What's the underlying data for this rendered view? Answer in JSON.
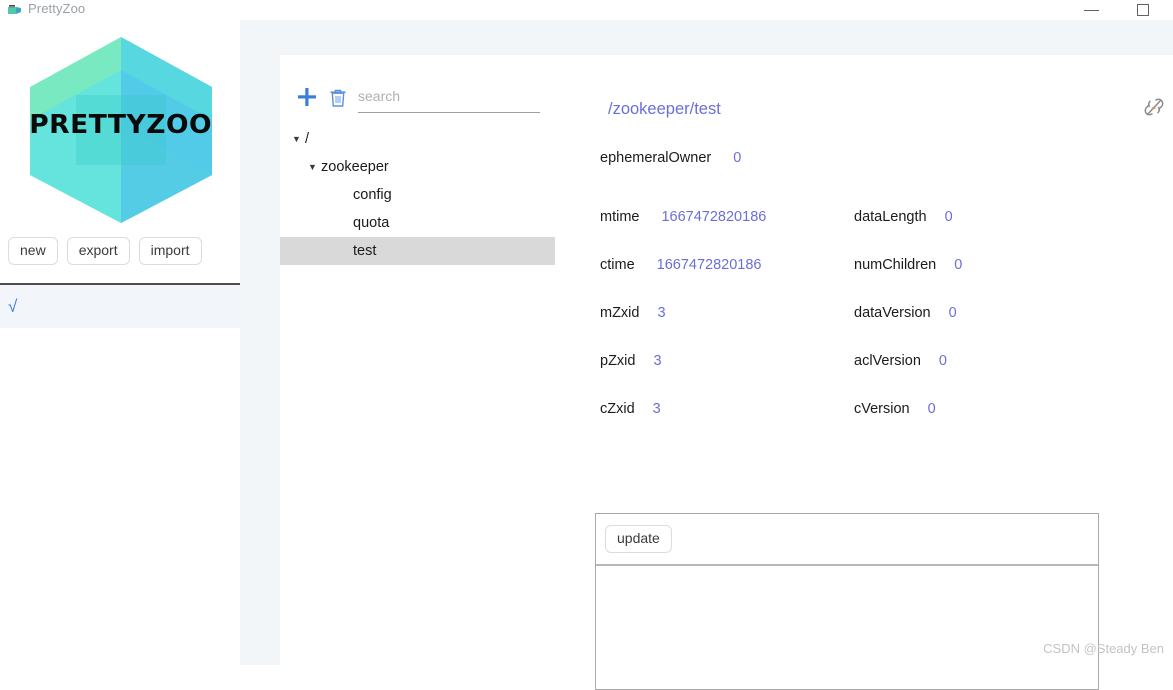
{
  "window": {
    "title": "PrettyZoo",
    "app_icon": "prettyzoo-logo-icon",
    "minimize_label": "—",
    "maximize_label": "□"
  },
  "sidebar": {
    "logo_text": "PRETTYZOO",
    "buttons": [
      {
        "label": "new",
        "name": "new-connection-button"
      },
      {
        "label": "export",
        "name": "export-button"
      },
      {
        "label": "import",
        "name": "import-button"
      }
    ],
    "connection_row": {
      "check_glyph": "√",
      "label": ""
    }
  },
  "toolbar": {
    "add_icon": "plus-icon",
    "delete_icon": "trash-icon",
    "search": {
      "placeholder": "search",
      "value": ""
    },
    "unlink_icon": "broken-link-icon"
  },
  "tree": {
    "nodes": [
      {
        "label": "/",
        "depth": 0,
        "caret": "▼",
        "selected": false
      },
      {
        "label": "zookeeper",
        "depth": 1,
        "caret": "▼",
        "selected": false
      },
      {
        "label": "config",
        "depth": 2,
        "caret": "",
        "selected": false
      },
      {
        "label": "quota",
        "depth": 2,
        "caret": "",
        "selected": false
      },
      {
        "label": "test",
        "depth": 2,
        "caret": "",
        "selected": true
      }
    ]
  },
  "node_detail": {
    "path": "/zookeeper/test",
    "ephemeral": {
      "key": "ephemeralOwner",
      "value": "0"
    },
    "rows": [
      {
        "left": {
          "key": "mtime",
          "value": "1667472820186"
        },
        "right": {
          "key": "dataLength",
          "value": "0"
        }
      },
      {
        "left": {
          "key": "ctime",
          "value": "1667472820186"
        },
        "right": {
          "key": "numChildren",
          "value": "0"
        }
      },
      {
        "left": {
          "key": "mZxid",
          "value": "3"
        },
        "right": {
          "key": "dataVersion",
          "value": "0"
        }
      },
      {
        "left": {
          "key": "pZxid",
          "value": "3"
        },
        "right": {
          "key": "aclVersion",
          "value": "0"
        }
      },
      {
        "left": {
          "key": "cZxid",
          "value": "3"
        },
        "right": {
          "key": "cVersion",
          "value": "0"
        }
      }
    ]
  },
  "data_panel": {
    "update_label": "update",
    "data_value": ""
  },
  "watermark": "CSDN @Steady Ben",
  "colors": {
    "accent_blue": "#3b7ddd",
    "value_purple": "#6b6fd8",
    "panel_bg": "#f2f6f9",
    "selection_gray": "#d9d9d9",
    "logo_green": "#69e3b4",
    "logo_cyan": "#5fd8e8"
  }
}
